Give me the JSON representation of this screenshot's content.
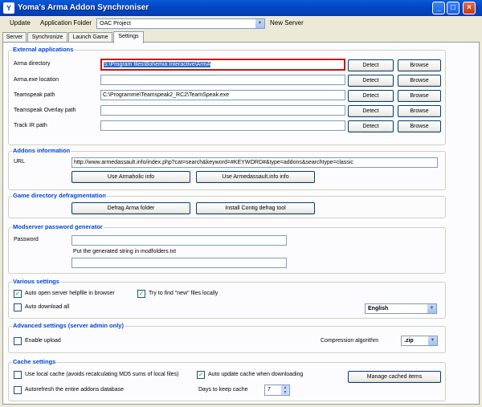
{
  "window": {
    "title": "Yoma's Arma Addon Synchroniser"
  },
  "menubar": {
    "update": "Update",
    "app_folder": "Application Folder",
    "folder_value": "OAC Project",
    "new_server": "New Server"
  },
  "tabs": [
    "Server",
    "Synchronize",
    "Launch Game",
    "Settings"
  ],
  "external": {
    "title": "External applications",
    "rows": [
      {
        "label": "Arma directory",
        "value": "S:\\Program files\\Bohemia Interactive\\ArmA"
      },
      {
        "label": "Arma.exe location",
        "value": ""
      },
      {
        "label": "Teamspeak path",
        "value": "C:\\Programme\\Teamspeak2_RC2\\TeamSpeak.exe"
      },
      {
        "label": "Teamspeak Overlay path",
        "value": ""
      },
      {
        "label": "Track IR path",
        "value": ""
      }
    ],
    "detect": "Detect",
    "browse": "Browse"
  },
  "addons": {
    "title": "Addons information",
    "url_label": "URL",
    "url_value": "http://www.armedassault.info/index.php?cat=search&keyword=#KEYWORD#&type=addons&searchtype=classic",
    "armaholic": "Use Armaholic info",
    "armedassault": "Use Armedassault.info info"
  },
  "defrag": {
    "title": "Game directory defragmentation",
    "defrag_btn": "Defrag Arma folder",
    "contig_btn": "Install Contig defrag tool"
  },
  "modserver": {
    "title": "Modserver password generator",
    "password_label": "Password",
    "password_value": "",
    "hint": "Put the generated string in modfolders.txt",
    "output_value": ""
  },
  "various": {
    "title": "Various settings",
    "auto_open": "Auto open server helpfile in browser",
    "try_find": "Try to find \"new\" files locally",
    "auto_download": "Auto download all",
    "language": "English"
  },
  "advanced": {
    "title": "Advanced settings (server admin only)",
    "enable_upload": "Enable upload",
    "compression_label": "Compression algorithm",
    "compression_value": ".zip"
  },
  "cache": {
    "title": "Cache settings",
    "use_local": "Use local cache (avoids recalculating MD5 sums of local files)",
    "auto_update": "Auto update cache when downloading",
    "manage": "Manage cached items",
    "autorefresh": "Autorefresh the entire addons database",
    "days_label": "Days to keep cache",
    "days_value": "7"
  },
  "icons": {
    "minimize": "minimize-icon",
    "maximize": "maximize-icon",
    "close": "close-icon",
    "check": "checkmark-icon"
  }
}
